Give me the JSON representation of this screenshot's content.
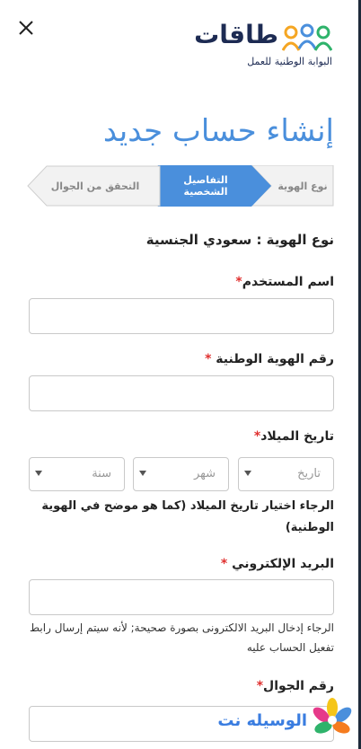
{
  "header": {
    "logo_name": "طاقات",
    "logo_tagline": "البوابة الوطنية للعمل"
  },
  "page_title": "إنشاء حساب جديد",
  "stepper": {
    "steps": [
      {
        "label": "نوع الهوية",
        "state": "done"
      },
      {
        "label": "التفاصيل الشخصية",
        "state": "active"
      },
      {
        "label": "التحقق من الجوال",
        "state": "pending"
      }
    ]
  },
  "id_type_text": "نوع الهوية : سعودي الجنسية",
  "form": {
    "username": {
      "label": "اسم المستخدم",
      "required_mark": "*",
      "value": ""
    },
    "national_id": {
      "label": "رقم الهوية الوطنية",
      "required_mark": "*",
      "value": ""
    },
    "birthdate": {
      "label": "تاريخ الميلاد",
      "required_mark": "*",
      "day_placeholder": "تاريخ",
      "month_placeholder": "شهر",
      "year_placeholder": "سنة",
      "note": "الرجاء اختيار تاريخ الميلاد (كما هو موضح في الهوية الوطنية)"
    },
    "email": {
      "label": "البريد الإلكتروني",
      "required_mark": "*",
      "value": "",
      "note": "الرجاء إدخال البريد الالكترونى بصورة صحيحة; لأنه سيتم إرسال رابط تفعيل الحساب عليه"
    },
    "mobile": {
      "label": "رقم الجوال",
      "required_mark": "*",
      "value": ""
    }
  },
  "watermark": {
    "text": "الوسيله نت"
  },
  "colors": {
    "accent": "#4a8fdc",
    "required": "#e0302f",
    "logo_navy": "#1d2b53",
    "step_inactive": "#f2f2f2"
  },
  "icons": {
    "close": "close-icon",
    "logo": "people-group-icon",
    "dropdown": "caret-down-icon",
    "watermark": "flower-icon"
  }
}
